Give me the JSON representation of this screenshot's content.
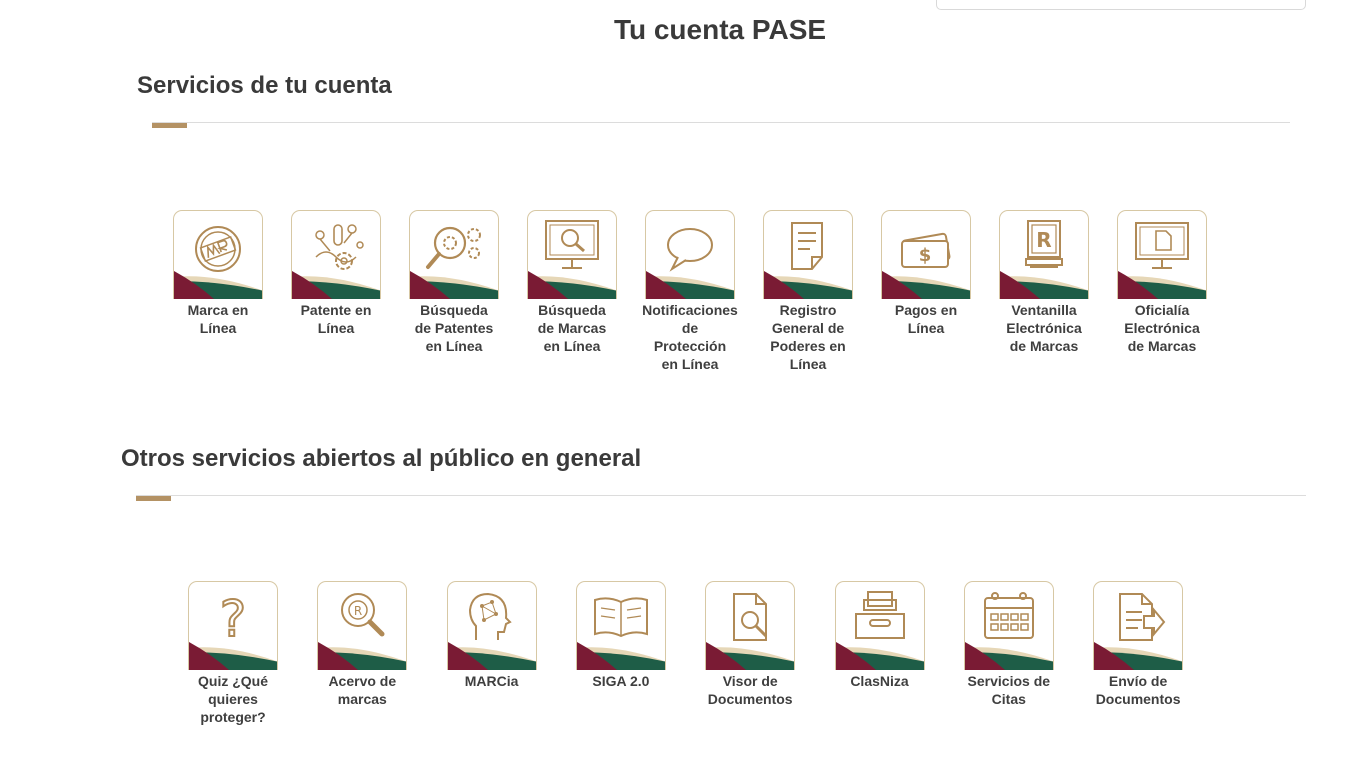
{
  "header": {
    "title": "Tu cuenta PASE"
  },
  "colors": {
    "accent_gold": "#b49264",
    "guinda": "#7a1b34",
    "green": "#1e5d47",
    "beige": "#e6d7b7"
  },
  "section_account": {
    "title": "Servicios de tu cuenta",
    "items": [
      {
        "label": "Marca en\nLínea",
        "icon": "mr-seal-icon"
      },
      {
        "label": "Patente en\nLínea",
        "icon": "dna-gear-icon"
      },
      {
        "label": "Búsqueda\nde Patentes\nen Línea",
        "icon": "search-gears-icon"
      },
      {
        "label": "Búsqueda\nde Marcas\nen Línea",
        "icon": "monitor-search-icon"
      },
      {
        "label": "Notificaciones\nde\nProtección\nen Línea",
        "icon": "speech-bubble-icon"
      },
      {
        "label": "Registro\nGeneral de\nPoderes en\nLínea",
        "icon": "document-icon"
      },
      {
        "label": "Pagos en\nLínea",
        "icon": "money-icon"
      },
      {
        "label": "Ventanilla\nElectrónica\nde Marcas",
        "icon": "registered-kiosk-icon"
      },
      {
        "label": "Oficialía\nElectrónica\nde Marcas",
        "icon": "monitor-document-icon"
      }
    ]
  },
  "section_public": {
    "title": "Otros servicios abiertos al público en general",
    "items": [
      {
        "label": "Quiz ¿Qué\nquieres\nproteger?",
        "icon": "question-icon"
      },
      {
        "label": "Acervo de\nmarcas",
        "icon": "registered-search-icon"
      },
      {
        "label": "MARCia",
        "icon": "ai-head-icon"
      },
      {
        "label": "SIGA 2.0",
        "icon": "open-book-icon"
      },
      {
        "label": "Visor de\nDocumentos",
        "icon": "file-search-icon"
      },
      {
        "label": "ClasNiza",
        "icon": "file-box-icon"
      },
      {
        "label": "Servicios de\nCitas",
        "icon": "calendar-icon"
      },
      {
        "label": "Envío de\nDocumentos",
        "icon": "send-document-icon"
      }
    ]
  }
}
